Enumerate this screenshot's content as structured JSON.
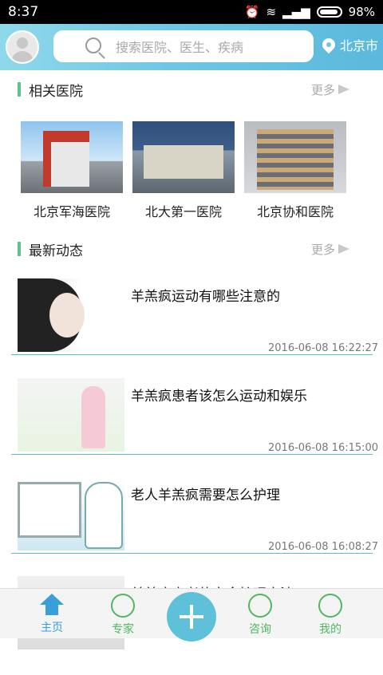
{
  "status_bar": {
    "time": "8:37",
    "battery": "98%"
  },
  "header": {
    "search_placeholder": "搜索医院、医生、疾病",
    "location": "北京市"
  },
  "hospitals_section": {
    "title": "相关医院",
    "more": "更多",
    "items": [
      {
        "name": "北京军海医院"
      },
      {
        "name": "北大第一医院"
      },
      {
        "name": "北京协和医院"
      }
    ]
  },
  "news_section": {
    "title": "最新动态",
    "more": "更多",
    "items": [
      {
        "title": "羊羔疯运动有哪些注意的",
        "time": "2016-06-08 16:22:27"
      },
      {
        "title": "羊羔疯患者该怎么运动和娱乐",
        "time": "2016-06-08 16:15:00"
      },
      {
        "title": "老人羊羔疯需要怎么护理",
        "time": "2016-06-08 16:08:27"
      },
      {
        "title": "羊羔疯患者的安全护理方法",
        "time": ""
      }
    ]
  },
  "tabbar": {
    "home": "主页",
    "experts": "专家",
    "consult": "咨询",
    "mine": "我的"
  },
  "colors": {
    "accent": "#5ec1d9",
    "tab_active": "#3a9fd8",
    "tab_inactive": "#4fb860",
    "section_bar": "#5cc38a"
  }
}
